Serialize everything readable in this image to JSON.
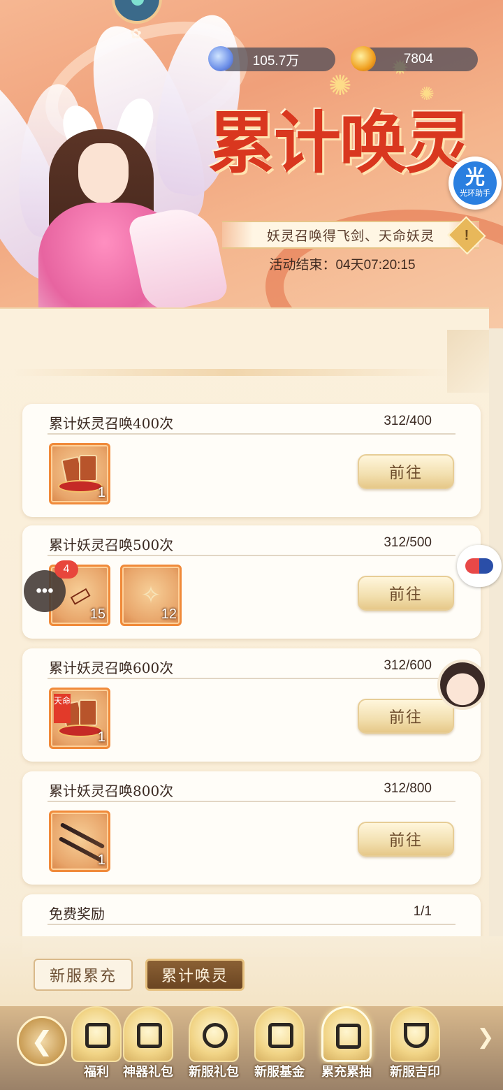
{
  "currencies": {
    "spirit_amount": "105.7万",
    "gold_amount": "7804"
  },
  "banner": {
    "title": "累计唤灵",
    "subtitle": "妖灵召唤得飞剑、天命妖灵",
    "timer_label": "活动结束：",
    "timer_value": "04天07:20:15",
    "info_icon": "!"
  },
  "helper_badge": {
    "glyph": "光",
    "label": "光环助手"
  },
  "tasks": [
    {
      "name": "累计妖灵召唤400次",
      "progress": "312/400",
      "button": "前往",
      "rewards": [
        {
          "icon": "card-pack-icon",
          "count": "1"
        }
      ]
    },
    {
      "name": "累计妖灵召唤500次",
      "progress": "312/500",
      "button": "前往",
      "rewards": [
        {
          "icon": "scroll-ticket-icon",
          "count": "15"
        },
        {
          "icon": "sword-fragment-icon",
          "count": "12"
        }
      ]
    },
    {
      "name": "累计妖灵召唤600次",
      "progress": "312/600",
      "button": "前往",
      "rewards": [
        {
          "icon": "tianming-card-pack-icon",
          "count": "1",
          "tag": "天命"
        }
      ]
    },
    {
      "name": "累计妖灵召唤800次",
      "progress": "312/800",
      "button": "前往",
      "rewards": [
        {
          "icon": "flying-swords-icon",
          "count": "1"
        }
      ]
    },
    {
      "name": "免费奖励",
      "progress": "1/1"
    }
  ],
  "chat": {
    "icon": "chat-icon",
    "badge": "4"
  },
  "tabs": [
    {
      "label": "新服累充",
      "active": false
    },
    {
      "label": "累计唤灵",
      "active": true
    }
  ],
  "bottom_nav": [
    {
      "label": "福利",
      "icon": "welfare-icon"
    },
    {
      "label": "神器礼包",
      "icon": "artifact-gift-icon"
    },
    {
      "label": "新服礼包",
      "icon": "new-server-gift-icon"
    },
    {
      "label": "新服基金",
      "icon": "new-server-fund-icon"
    },
    {
      "label": "累充累抽",
      "icon": "cumulative-draw-icon",
      "active": true
    },
    {
      "label": "新服吉印",
      "icon": "new-server-seal-icon"
    }
  ],
  "colors": {
    "title_red": "#d9371f",
    "accent_orange": "#f08a3a",
    "paper": "#fbf0dc",
    "tab_active": "#6b4522"
  }
}
